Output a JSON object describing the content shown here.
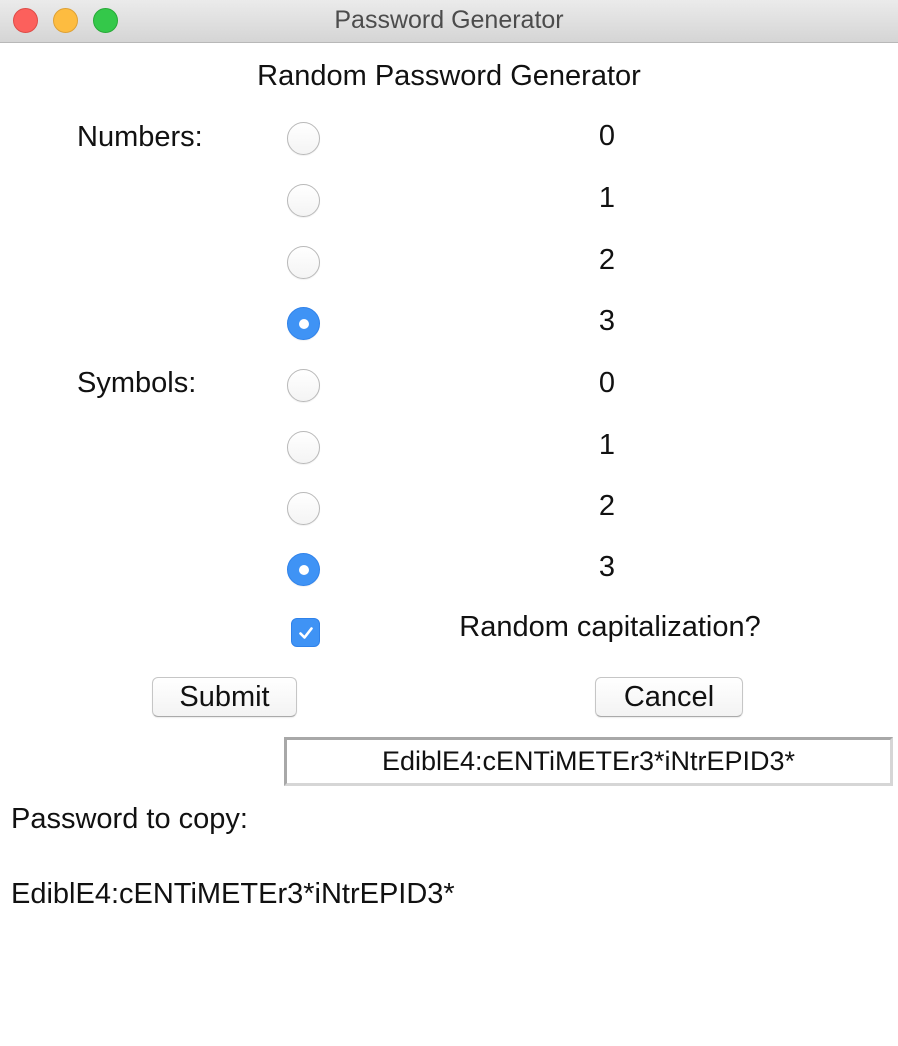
{
  "window": {
    "title": "Password Generator",
    "controls": [
      "close-icon",
      "minimize-icon",
      "maximize-icon"
    ]
  },
  "heading": "Random Password Generator",
  "numbers": {
    "label": "Numbers:",
    "options": [
      "0",
      "1",
      "2",
      "3"
    ],
    "selected": "3"
  },
  "symbols": {
    "label": "Symbols:",
    "options": [
      "0",
      "1",
      "2",
      "3"
    ],
    "selected": "3"
  },
  "capitalization": {
    "label": "Random capitalization?",
    "checked": true
  },
  "buttons": {
    "submit": "Submit",
    "cancel": "Cancel"
  },
  "generated_password": "EdiblE4:cENTiMETEr3*iNtrEPID3*",
  "copy": {
    "label": "Password to copy:",
    "value": "EdiblE4:cENTiMETEr3*iNtrEPID3*"
  },
  "colors": {
    "accent": "#3f93f5",
    "close": "#fc605c",
    "minimize": "#fdbc40",
    "maximize": "#34c84a"
  }
}
